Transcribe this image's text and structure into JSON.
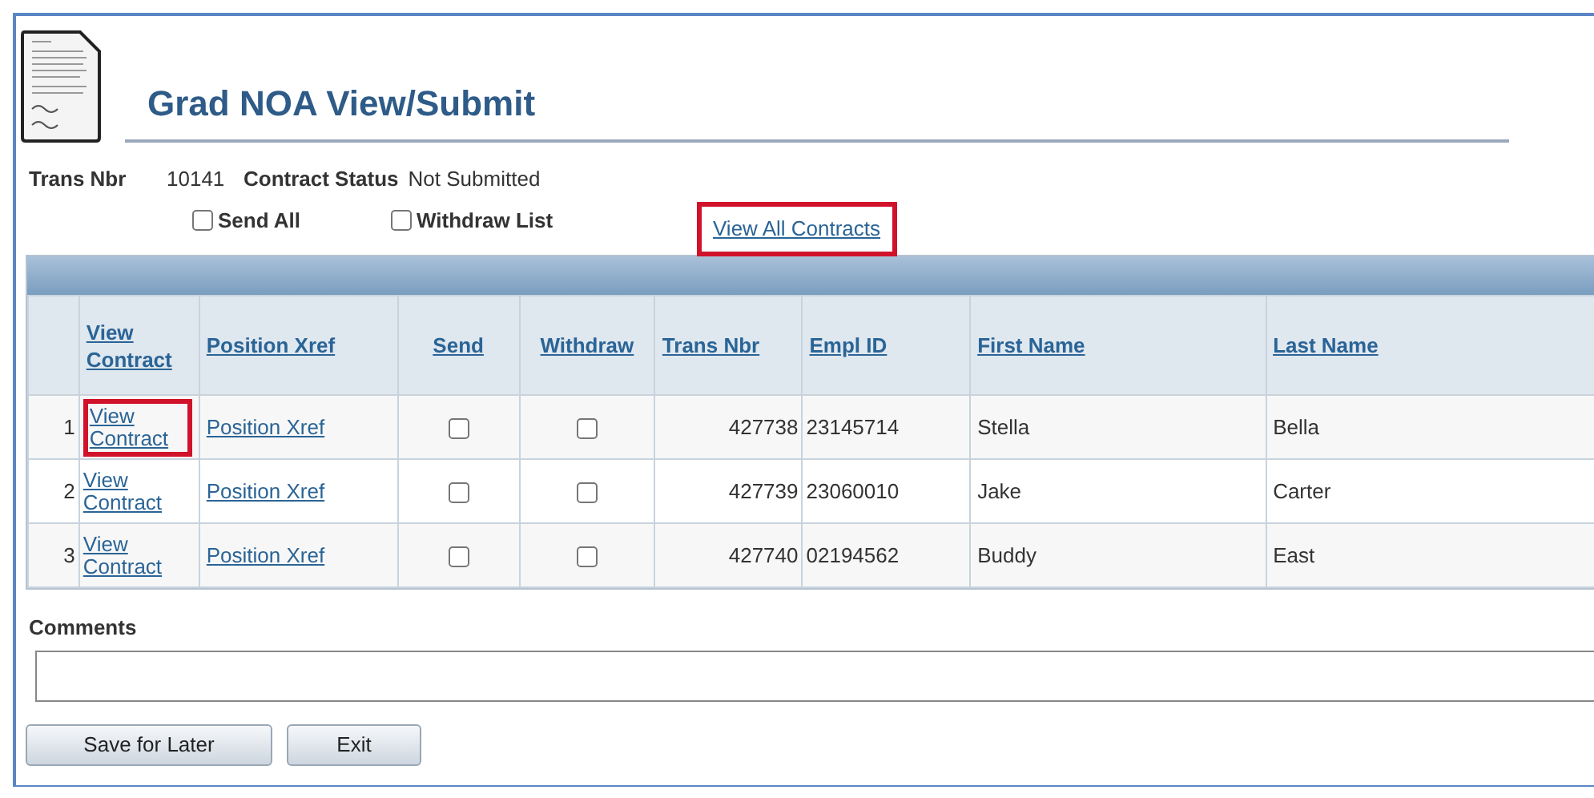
{
  "page": {
    "title": "Grad NOA View/Submit"
  },
  "header": {
    "trans_nbr_label": "Trans Nbr",
    "trans_nbr": "10141",
    "status_label": "Contract Status",
    "status": "Not Submitted"
  },
  "options": [
    {
      "label": "Send All",
      "checked": false
    },
    {
      "label": "Withdraw List",
      "checked": false
    }
  ],
  "view_all_link": {
    "label": "View All Contracts",
    "highlighted": true
  },
  "table": {
    "columns": [
      "View Contract",
      "Position Xref",
      "Send",
      "Withdraw",
      "Trans Nbr",
      "Empl ID",
      "First Name",
      "Last Name"
    ],
    "rows": [
      {
        "row_number": "1",
        "view_contract": "View Contract",
        "view_highlighted": true,
        "position_xref": "Position Xref",
        "send": false,
        "withdraw": false,
        "trans_nbr": "427738",
        "empl_id": "23145714",
        "first_name": "Stella",
        "last_name": "Bella"
      },
      {
        "row_number": "2",
        "view_contract": "View Contract",
        "view_highlighted": false,
        "position_xref": "Position Xref",
        "send": false,
        "withdraw": false,
        "trans_nbr": "427739",
        "empl_id": "23060010",
        "first_name": "Jake",
        "last_name": "Carter"
      },
      {
        "row_number": "3",
        "view_contract": "View Contract",
        "view_highlighted": false,
        "position_xref": "Position Xref",
        "send": false,
        "withdraw": false,
        "trans_nbr": "427740",
        "empl_id": "02194562",
        "first_name": "Buddy",
        "last_name": "East"
      }
    ]
  },
  "comments": {
    "label": "Comments"
  },
  "buttons": [
    "Save for Later",
    "Exit"
  ]
}
